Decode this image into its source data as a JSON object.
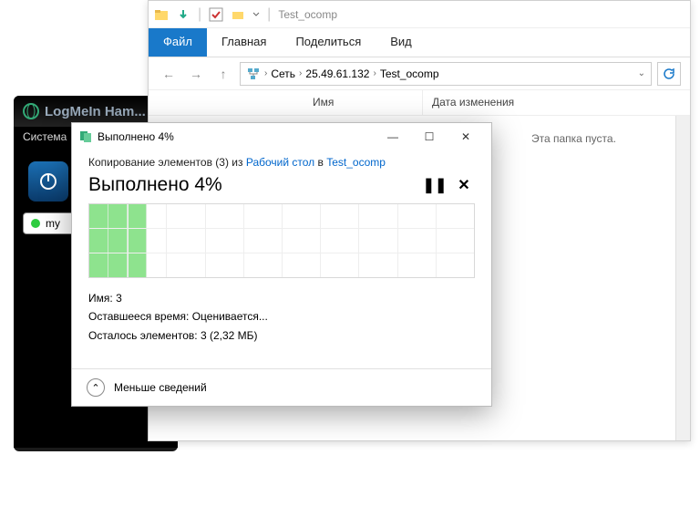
{
  "logmein": {
    "title": "LogMeIn Ham...",
    "subtitle": "Система",
    "my_label": "my"
  },
  "explorer": {
    "window_title": "Test_ocomp",
    "tabs": {
      "file": "Файл",
      "home": "Главная",
      "share": "Поделиться",
      "view": "Вид"
    },
    "address": {
      "root": "Сеть",
      "ip": "25.49.61.132",
      "folder": "Test_ocomp"
    },
    "columns": {
      "name": "Имя",
      "date": "Дата изменения"
    },
    "empty": "Эта папка пуста."
  },
  "copy_dialog": {
    "title": "Выполнено 4%",
    "copying_prefix": "Копирование элементов (3) из ",
    "copying_src": "Рабочий стол",
    "copying_mid": " в ",
    "copying_dst": "Test_ocomp",
    "heading": "Выполнено 4%",
    "progress_percent": 4,
    "meta": {
      "name_label": "Имя:",
      "name_value": "3",
      "time_label": "Оставшееся время:",
      "time_value": "Оценивается...",
      "items_label": "Осталось элементов:",
      "items_value": "3 (2,32 МБ)"
    },
    "less_details": "Меньше сведений"
  }
}
